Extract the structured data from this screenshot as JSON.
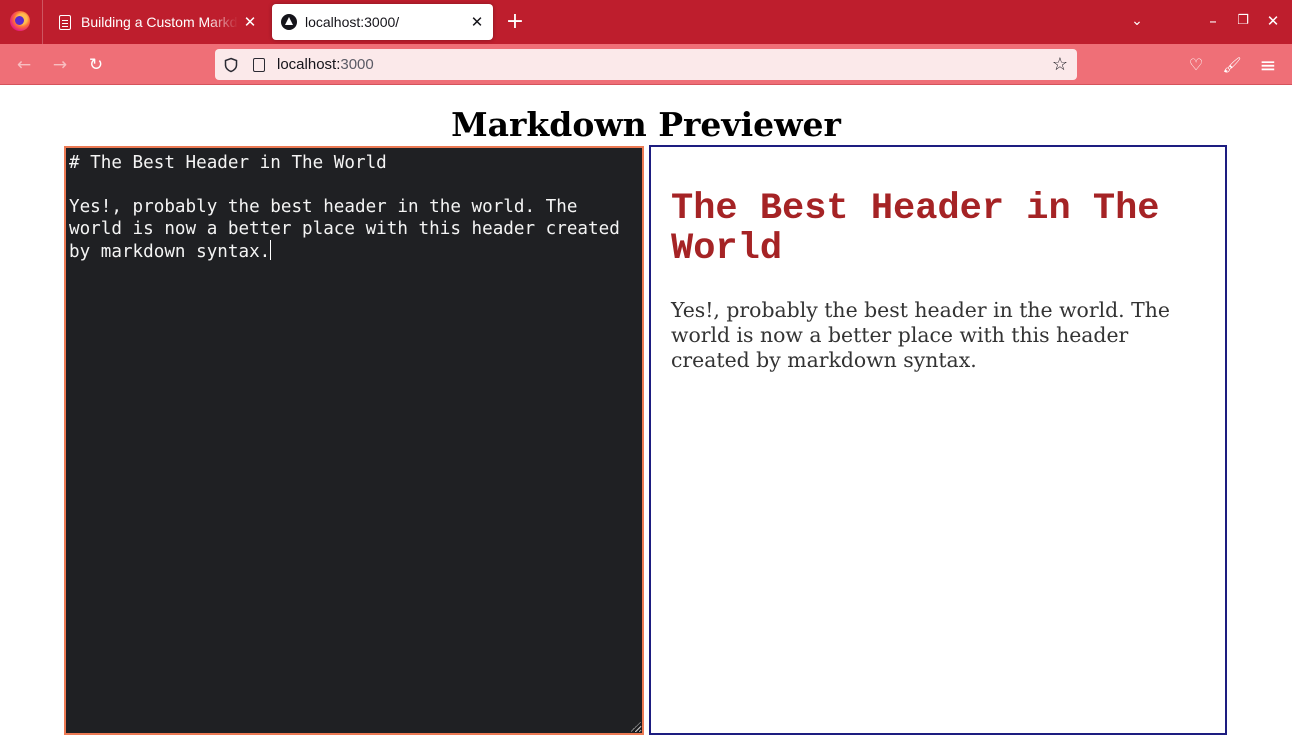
{
  "browser": {
    "tabs": [
      {
        "title": "Building a Custom Markdown",
        "close": "✕"
      },
      {
        "title": "localhost:3000/",
        "close": "✕"
      }
    ],
    "new_tab": "+",
    "tab_list": "⌄",
    "window": {
      "minimize": "–",
      "restore": "❐",
      "close": "✕"
    },
    "url_host": "localhost:",
    "url_port": "3000",
    "back": "←",
    "forward": "→",
    "reload": "↻",
    "bookmark": "☆",
    "pocket": "♡",
    "extension": "🖌",
    "menu": "≡"
  },
  "app": {
    "title": "Markdown Previewer",
    "editor_text": "# The Best Header in The World\n\nYes!, probably the best header in the world. The world is now a better place with this header created by markdown syntax.",
    "preview": {
      "heading": "The Best Header in The World",
      "paragraph": "Yes!, probably the best header in the world. The world is now a better place with this header created by markdown syntax."
    }
  },
  "colors": {
    "tab_strip": "#be1e2d",
    "nav_bar": "#ef6f77",
    "editor_bg": "#1f2023",
    "editor_border": "#ec7a54",
    "preview_border": "#1d1d80",
    "heading_color": "#a52325"
  }
}
